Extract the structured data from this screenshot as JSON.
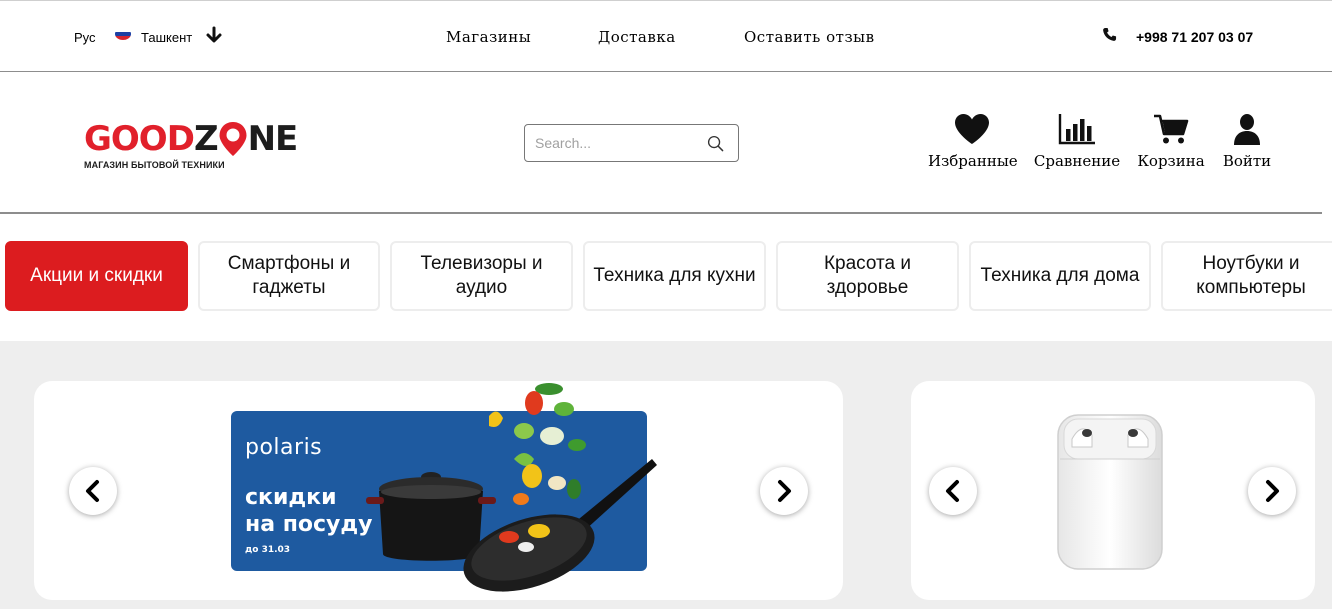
{
  "topbar": {
    "language": "Рус",
    "city": "Ташкент",
    "nav": [
      "Магазины",
      "Доставка",
      "Оставить отзыв"
    ],
    "phone": "+998 71 207 03 07"
  },
  "header": {
    "logo": {
      "word": "GOODZONE",
      "tagline": "МАГАЗИН БЫТОВОЙ ТЕХНИКИ"
    },
    "search_placeholder": "Search...",
    "icons": [
      {
        "label": "Избранные",
        "icon": "heart-icon"
      },
      {
        "label": "Сравнение",
        "icon": "bar-chart-icon"
      },
      {
        "label": "Корзина",
        "icon": "cart-icon"
      },
      {
        "label": "Войти",
        "icon": "user-icon"
      }
    ]
  },
  "categories": [
    {
      "label": "Акции и скидки",
      "active": true
    },
    {
      "label": "Смартфоны и гаджеты",
      "active": false
    },
    {
      "label": "Телевизоры и аудио",
      "active": false
    },
    {
      "label": "Техника для кухни",
      "active": false
    },
    {
      "label": "Красота и здоровье",
      "active": false
    },
    {
      "label": "Техника для дома",
      "active": false
    },
    {
      "label": "Ноутбуки и компьютеры",
      "active": false
    }
  ],
  "banner": {
    "brand": "polaris",
    "promo_line1": "скидки",
    "promo_line2": "на посуду",
    "date": "до 31.03"
  },
  "colors": {
    "accent": "#dc1c1f",
    "banner_blue": "#1e5aa0",
    "page_bg": "#eeeeee"
  }
}
